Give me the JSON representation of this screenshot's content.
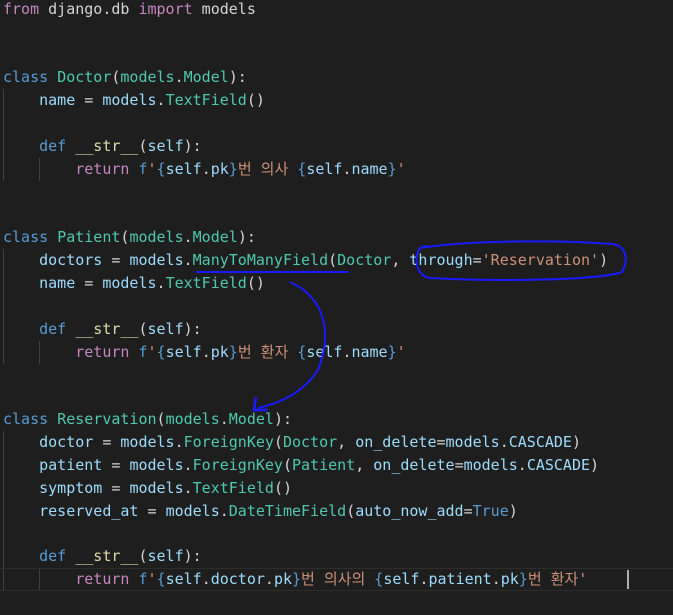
{
  "colors": {
    "background": "#1e1e1e",
    "keyword": "#569cd6",
    "control_keyword": "#c586c0",
    "class_name": "#4ec9b0",
    "function": "#dcdcaa",
    "variable": "#9cdcfe",
    "string": "#ce9178",
    "punctuation": "#d4d4d4",
    "annotation_ink": "#1a1aff"
  },
  "code": {
    "l1": [
      {
        "t": "kwc",
        "s": "from"
      },
      {
        "t": "pun",
        "s": " django.db "
      },
      {
        "t": "kwc",
        "s": "import"
      },
      {
        "t": "pun",
        "s": " models"
      }
    ],
    "l4": [
      {
        "t": "kw",
        "s": "class"
      },
      {
        "t": "pun",
        "s": " "
      },
      {
        "t": "cls",
        "s": "Doctor"
      },
      {
        "t": "pun",
        "s": "("
      },
      {
        "t": "cls",
        "s": "models"
      },
      {
        "t": "pun",
        "s": "."
      },
      {
        "t": "cls",
        "s": "Model"
      },
      {
        "t": "pun",
        "s": "):"
      }
    ],
    "l5": [
      {
        "t": "pun",
        "s": "    "
      },
      {
        "t": "var",
        "s": "name"
      },
      {
        "t": "pun",
        "s": " = "
      },
      {
        "t": "var",
        "s": "models"
      },
      {
        "t": "pun",
        "s": "."
      },
      {
        "t": "cls",
        "s": "TextField"
      },
      {
        "t": "pun",
        "s": "()"
      }
    ],
    "l7": [
      {
        "t": "pun",
        "s": "    "
      },
      {
        "t": "kw",
        "s": "def"
      },
      {
        "t": "pun",
        "s": " "
      },
      {
        "t": "fn",
        "s": "__str__"
      },
      {
        "t": "pun",
        "s": "("
      },
      {
        "t": "var",
        "s": "self"
      },
      {
        "t": "pun",
        "s": "):"
      }
    ],
    "l8": [
      {
        "t": "pun",
        "s": "        "
      },
      {
        "t": "kwc",
        "s": "return"
      },
      {
        "t": "pun",
        "s": " "
      },
      {
        "t": "kw",
        "s": "f"
      },
      {
        "t": "str",
        "s": "'"
      },
      {
        "t": "kw",
        "s": "{"
      },
      {
        "t": "var",
        "s": "self"
      },
      {
        "t": "pun",
        "s": "."
      },
      {
        "t": "var",
        "s": "pk"
      },
      {
        "t": "kw",
        "s": "}"
      },
      {
        "t": "str",
        "s": "번 의사 "
      },
      {
        "t": "kw",
        "s": "{"
      },
      {
        "t": "var",
        "s": "self"
      },
      {
        "t": "pun",
        "s": "."
      },
      {
        "t": "var",
        "s": "name"
      },
      {
        "t": "kw",
        "s": "}"
      },
      {
        "t": "str",
        "s": "'"
      }
    ],
    "l11": [
      {
        "t": "kw",
        "s": "class"
      },
      {
        "t": "pun",
        "s": " "
      },
      {
        "t": "cls",
        "s": "Patient"
      },
      {
        "t": "pun",
        "s": "("
      },
      {
        "t": "cls",
        "s": "models"
      },
      {
        "t": "pun",
        "s": "."
      },
      {
        "t": "cls",
        "s": "Model"
      },
      {
        "t": "pun",
        "s": "):"
      }
    ],
    "l12": [
      {
        "t": "pun",
        "s": "    "
      },
      {
        "t": "var",
        "s": "doctors"
      },
      {
        "t": "pun",
        "s": " = "
      },
      {
        "t": "var",
        "s": "models"
      },
      {
        "t": "pun",
        "s": "."
      },
      {
        "t": "cls",
        "s": "ManyToManyField"
      },
      {
        "t": "pun",
        "s": "("
      },
      {
        "t": "cls",
        "s": "Doctor"
      },
      {
        "t": "pun",
        "s": ", "
      },
      {
        "t": "var",
        "s": "through"
      },
      {
        "t": "pun",
        "s": "="
      },
      {
        "t": "str",
        "s": "'Reservation'"
      },
      {
        "t": "pun",
        "s": ")"
      }
    ],
    "l13": [
      {
        "t": "pun",
        "s": "    "
      },
      {
        "t": "var",
        "s": "name"
      },
      {
        "t": "pun",
        "s": " = "
      },
      {
        "t": "var",
        "s": "models"
      },
      {
        "t": "pun",
        "s": "."
      },
      {
        "t": "cls",
        "s": "TextField"
      },
      {
        "t": "pun",
        "s": "()"
      }
    ],
    "l15": [
      {
        "t": "pun",
        "s": "    "
      },
      {
        "t": "kw",
        "s": "def"
      },
      {
        "t": "pun",
        "s": " "
      },
      {
        "t": "fn",
        "s": "__str__"
      },
      {
        "t": "pun",
        "s": "("
      },
      {
        "t": "var",
        "s": "self"
      },
      {
        "t": "pun",
        "s": "):"
      }
    ],
    "l16": [
      {
        "t": "pun",
        "s": "        "
      },
      {
        "t": "kwc",
        "s": "return"
      },
      {
        "t": "pun",
        "s": " "
      },
      {
        "t": "kw",
        "s": "f"
      },
      {
        "t": "str",
        "s": "'"
      },
      {
        "t": "kw",
        "s": "{"
      },
      {
        "t": "var",
        "s": "self"
      },
      {
        "t": "pun",
        "s": "."
      },
      {
        "t": "var",
        "s": "pk"
      },
      {
        "t": "kw",
        "s": "}"
      },
      {
        "t": "str",
        "s": "번 환자 "
      },
      {
        "t": "kw",
        "s": "{"
      },
      {
        "t": "var",
        "s": "self"
      },
      {
        "t": "pun",
        "s": "."
      },
      {
        "t": "var",
        "s": "name"
      },
      {
        "t": "kw",
        "s": "}"
      },
      {
        "t": "str",
        "s": "'"
      }
    ],
    "l19": [
      {
        "t": "kw",
        "s": "class"
      },
      {
        "t": "pun",
        "s": " "
      },
      {
        "t": "cls",
        "s": "Reservation"
      },
      {
        "t": "pun",
        "s": "("
      },
      {
        "t": "cls",
        "s": "models"
      },
      {
        "t": "pun",
        "s": "."
      },
      {
        "t": "cls",
        "s": "Model"
      },
      {
        "t": "pun",
        "s": "):"
      }
    ],
    "l20": [
      {
        "t": "pun",
        "s": "    "
      },
      {
        "t": "var",
        "s": "doctor"
      },
      {
        "t": "pun",
        "s": " = "
      },
      {
        "t": "var",
        "s": "models"
      },
      {
        "t": "pun",
        "s": "."
      },
      {
        "t": "cls",
        "s": "ForeignKey"
      },
      {
        "t": "pun",
        "s": "("
      },
      {
        "t": "cls",
        "s": "Doctor"
      },
      {
        "t": "pun",
        "s": ", "
      },
      {
        "t": "var",
        "s": "on_delete"
      },
      {
        "t": "pun",
        "s": "="
      },
      {
        "t": "var",
        "s": "models"
      },
      {
        "t": "pun",
        "s": "."
      },
      {
        "t": "var",
        "s": "CASCADE"
      },
      {
        "t": "pun",
        "s": ")"
      }
    ],
    "l21": [
      {
        "t": "pun",
        "s": "    "
      },
      {
        "t": "var",
        "s": "patient"
      },
      {
        "t": "pun",
        "s": " = "
      },
      {
        "t": "var",
        "s": "models"
      },
      {
        "t": "pun",
        "s": "."
      },
      {
        "t": "cls",
        "s": "ForeignKey"
      },
      {
        "t": "pun",
        "s": "("
      },
      {
        "t": "cls",
        "s": "Patient"
      },
      {
        "t": "pun",
        "s": ", "
      },
      {
        "t": "var",
        "s": "on_delete"
      },
      {
        "t": "pun",
        "s": "="
      },
      {
        "t": "var",
        "s": "models"
      },
      {
        "t": "pun",
        "s": "."
      },
      {
        "t": "var",
        "s": "CASCADE"
      },
      {
        "t": "pun",
        "s": ")"
      }
    ],
    "l22": [
      {
        "t": "pun",
        "s": "    "
      },
      {
        "t": "var",
        "s": "symptom"
      },
      {
        "t": "pun",
        "s": " = "
      },
      {
        "t": "var",
        "s": "models"
      },
      {
        "t": "pun",
        "s": "."
      },
      {
        "t": "cls",
        "s": "TextField"
      },
      {
        "t": "pun",
        "s": "()"
      }
    ],
    "l23": [
      {
        "t": "pun",
        "s": "    "
      },
      {
        "t": "var",
        "s": "reserved_at"
      },
      {
        "t": "pun",
        "s": " = "
      },
      {
        "t": "var",
        "s": "models"
      },
      {
        "t": "pun",
        "s": "."
      },
      {
        "t": "cls",
        "s": "DateTimeField"
      },
      {
        "t": "pun",
        "s": "("
      },
      {
        "t": "var",
        "s": "auto_now_add"
      },
      {
        "t": "pun",
        "s": "="
      },
      {
        "t": "kw",
        "s": "True"
      },
      {
        "t": "pun",
        "s": ")"
      }
    ],
    "l25": [
      {
        "t": "pun",
        "s": "    "
      },
      {
        "t": "kw",
        "s": "def"
      },
      {
        "t": "pun",
        "s": " "
      },
      {
        "t": "fn",
        "s": "__str__"
      },
      {
        "t": "pun",
        "s": "("
      },
      {
        "t": "var",
        "s": "self"
      },
      {
        "t": "pun",
        "s": "):"
      }
    ],
    "l26": [
      {
        "t": "pun",
        "s": "        "
      },
      {
        "t": "kwc",
        "s": "return"
      },
      {
        "t": "pun",
        "s": " "
      },
      {
        "t": "kw",
        "s": "f"
      },
      {
        "t": "str",
        "s": "'"
      },
      {
        "t": "kw",
        "s": "{"
      },
      {
        "t": "var",
        "s": "self"
      },
      {
        "t": "pun",
        "s": "."
      },
      {
        "t": "var",
        "s": "doctor"
      },
      {
        "t": "pun",
        "s": "."
      },
      {
        "t": "var",
        "s": "pk"
      },
      {
        "t": "kw",
        "s": "}"
      },
      {
        "t": "str",
        "s": "번 의사의 "
      },
      {
        "t": "kw",
        "s": "{"
      },
      {
        "t": "var",
        "s": "self"
      },
      {
        "t": "pun",
        "s": "."
      },
      {
        "t": "var",
        "s": "patient"
      },
      {
        "t": "pun",
        "s": "."
      },
      {
        "t": "var",
        "s": "pk"
      },
      {
        "t": "kw",
        "s": "}"
      },
      {
        "t": "str",
        "s": "번 환자'"
      }
    ]
  }
}
